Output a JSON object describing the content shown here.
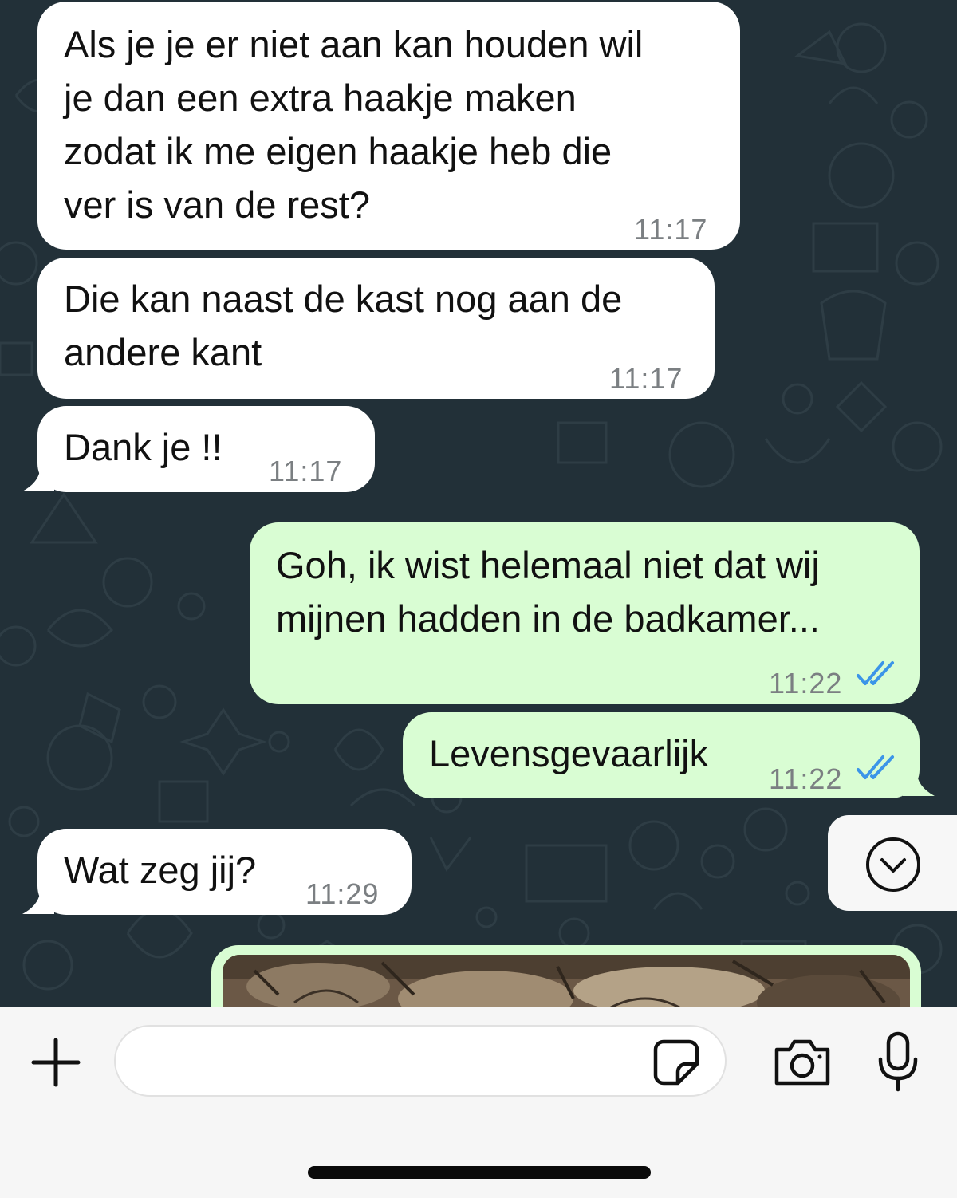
{
  "colors": {
    "wallpaper": "#223038",
    "incoming_bubble": "#ffffff",
    "outgoing_bubble": "#d9fdd3",
    "read_ticks": "#3b95e8",
    "timestamp": "#7b7f82",
    "input_bar": "#f6f6f6"
  },
  "messages": [
    {
      "direction": "incoming",
      "lines": [
        "Als je je er niet aan kan houden wil",
        "je dan een extra haakje maken",
        "zodat ik me eigen haakje heb die",
        "ver is van de rest?"
      ],
      "time": "11:17"
    },
    {
      "direction": "incoming",
      "lines": [
        "Die kan naast de kast nog aan de",
        "andere kant"
      ],
      "time": "11:17"
    },
    {
      "direction": "incoming",
      "lines": [
        "Dank je !!"
      ],
      "time": "11:17"
    },
    {
      "direction": "outgoing",
      "lines": [
        "Goh, ik wist helemaal niet dat wij",
        "mijnen hadden in de badkamer..."
      ],
      "time": "11:22",
      "status": "read"
    },
    {
      "direction": "outgoing",
      "lines": [
        "Levensgevaarlijk"
      ],
      "time": "11:22",
      "status": "read"
    },
    {
      "direction": "incoming",
      "lines": [
        "Wat zeg jij?"
      ],
      "time": "11:29"
    }
  ],
  "scroll_button": {
    "icon": "chevron-down-circle-icon"
  },
  "input_bar": {
    "message_value": "",
    "icons": [
      "plus-icon",
      "sticker-icon",
      "camera-icon",
      "microphone-icon"
    ]
  }
}
